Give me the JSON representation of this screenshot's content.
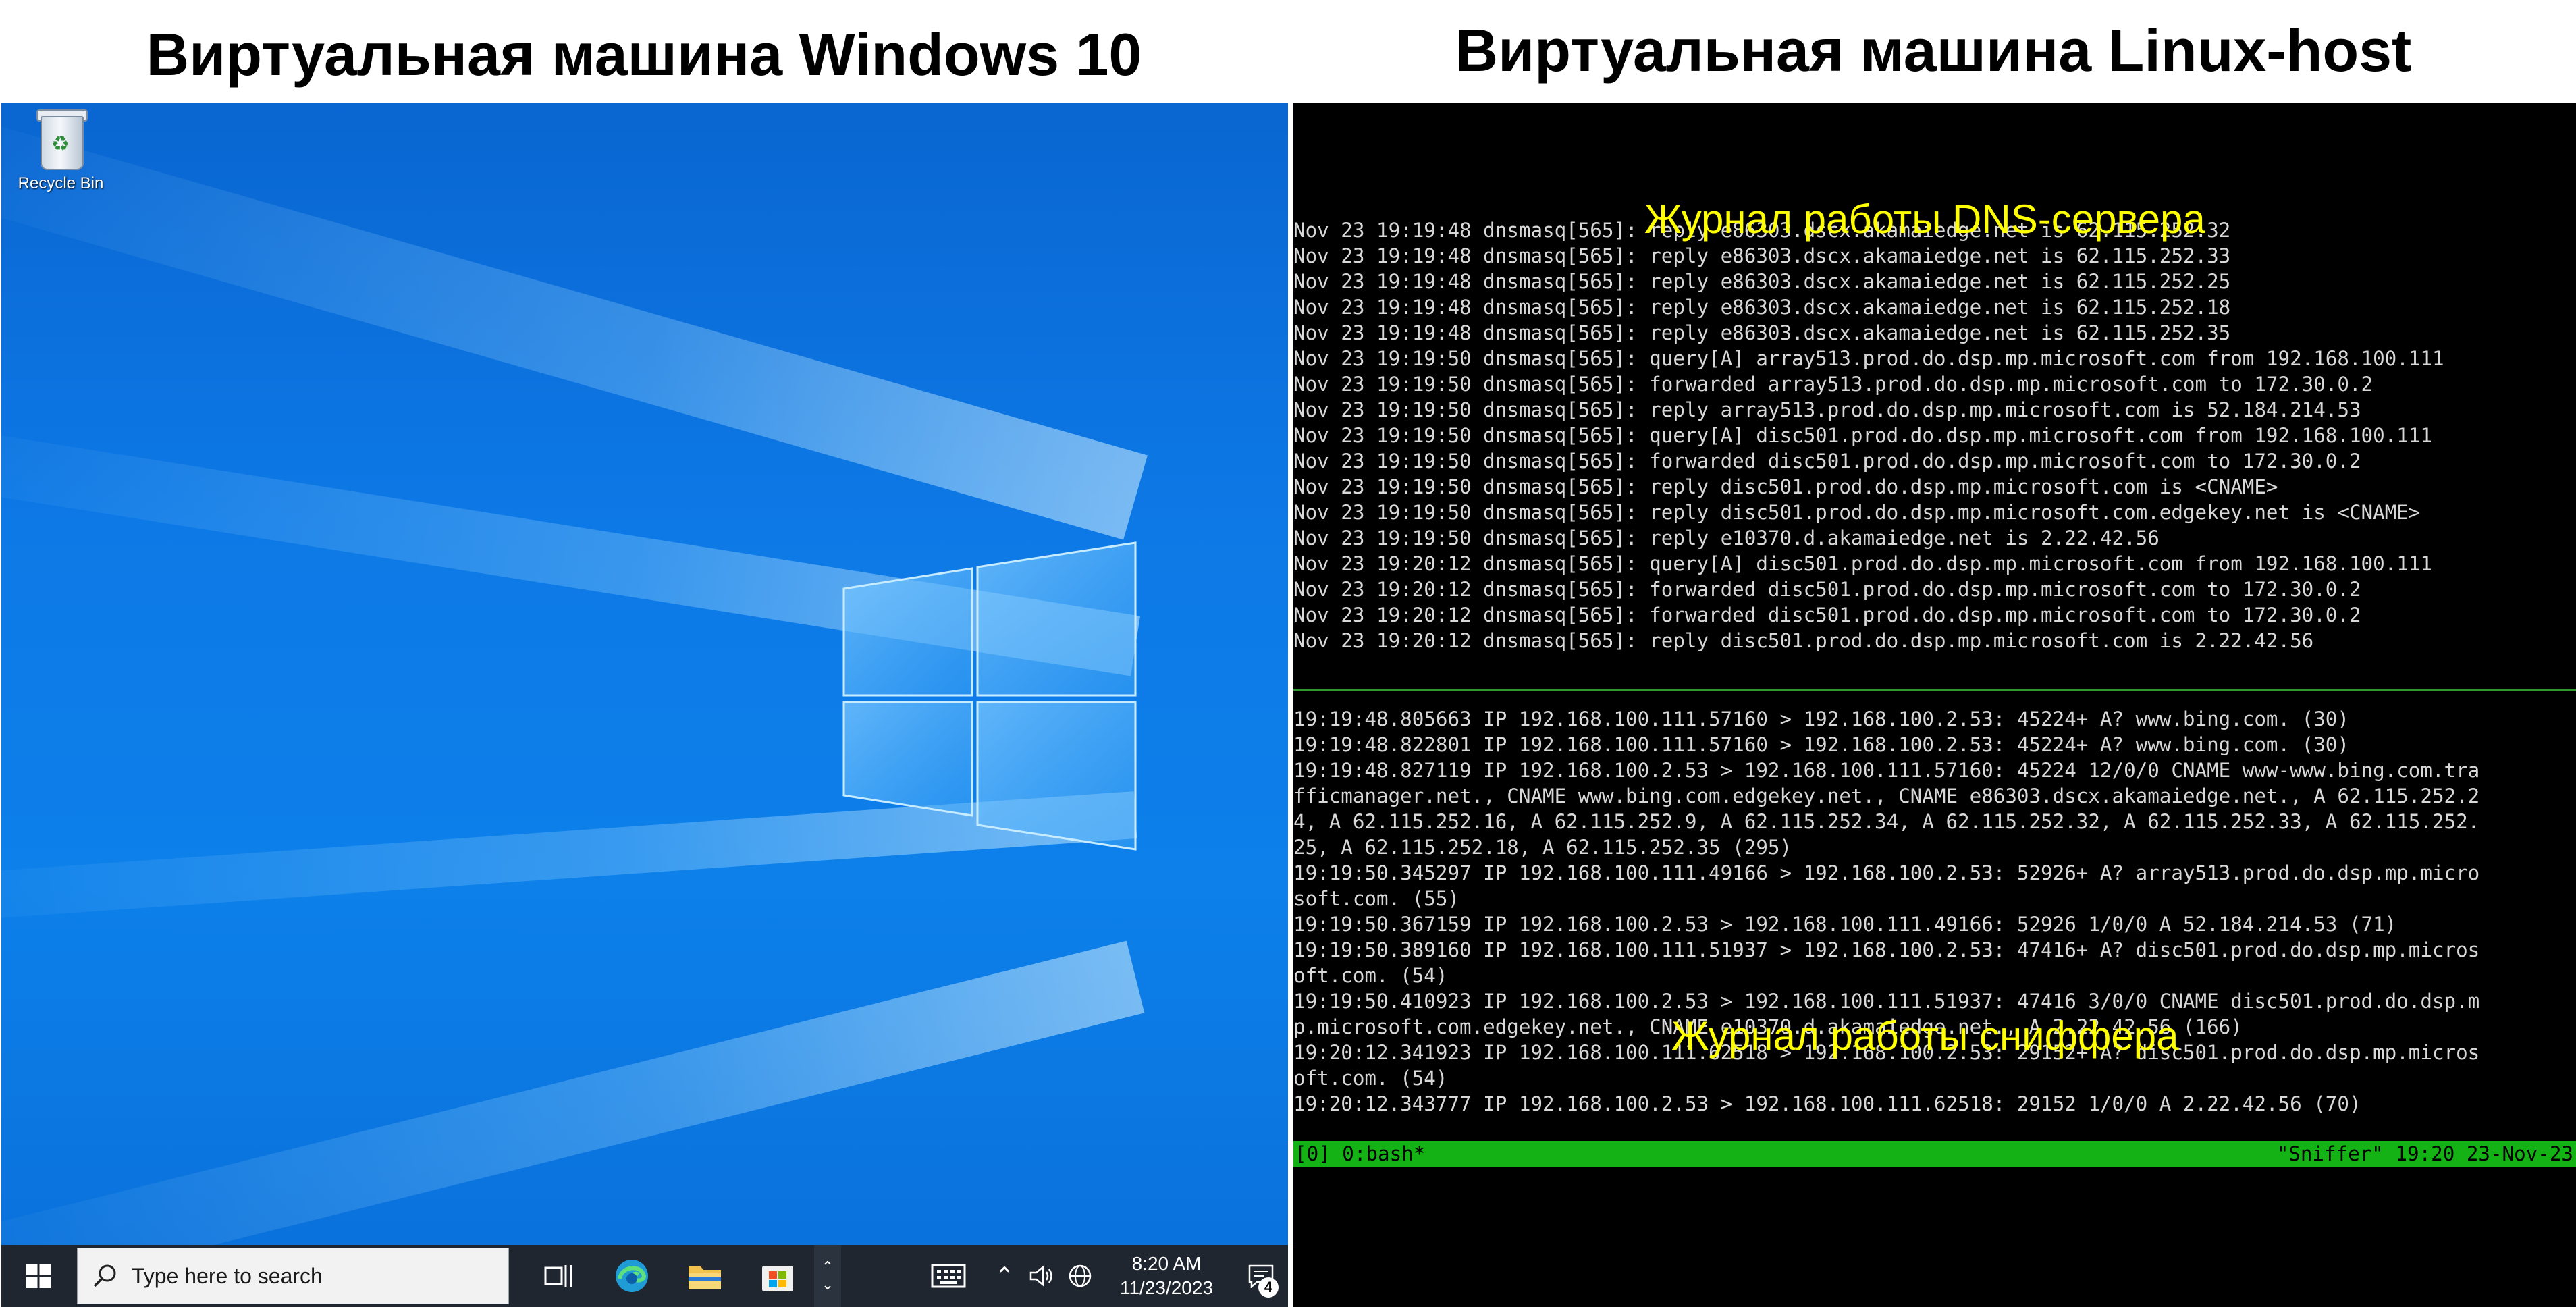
{
  "headings": {
    "windows_vm": "Виртуальная машина Windows 10",
    "linux_vm": "Виртуальная машина Linux-host"
  },
  "windows": {
    "desktop": {
      "recycle_bin_label": "Recycle Bin",
      "recycle_bin_icon": "recycle-bin-icon"
    },
    "taskbar": {
      "start_icon": "windows-logo-icon",
      "search_placeholder": "Type here to search",
      "apps": [
        "task-view-icon",
        "edge-icon",
        "file-explorer-icon",
        "microsoft-store-icon"
      ],
      "tray_icons": [
        "chevron-up-icon",
        "speaker-icon",
        "globe-icon",
        "keyboard-icon"
      ],
      "clock_time": "8:20 AM",
      "clock_date": "11/23/2023",
      "notification_count": "4"
    }
  },
  "linux": {
    "overlay_dns": "Журнал работы DNS-сервера",
    "overlay_sniffer": "Журнал работы сниффера",
    "dns_log": [
      "Nov 23 19:19:48 dnsmasq[565]: reply e86303.dscx.akamaiedge.net is 62.115.252.32",
      "Nov 23 19:19:48 dnsmasq[565]: reply e86303.dscx.akamaiedge.net is 62.115.252.33",
      "Nov 23 19:19:48 dnsmasq[565]: reply e86303.dscx.akamaiedge.net is 62.115.252.25",
      "Nov 23 19:19:48 dnsmasq[565]: reply e86303.dscx.akamaiedge.net is 62.115.252.18",
      "Nov 23 19:19:48 dnsmasq[565]: reply e86303.dscx.akamaiedge.net is 62.115.252.35",
      "Nov 23 19:19:50 dnsmasq[565]: query[A] array513.prod.do.dsp.mp.microsoft.com from 192.168.100.111",
      "Nov 23 19:19:50 dnsmasq[565]: forwarded array513.prod.do.dsp.mp.microsoft.com to 172.30.0.2",
      "Nov 23 19:19:50 dnsmasq[565]: reply array513.prod.do.dsp.mp.microsoft.com is 52.184.214.53",
      "Nov 23 19:19:50 dnsmasq[565]: query[A] disc501.prod.do.dsp.mp.microsoft.com from 192.168.100.111",
      "Nov 23 19:19:50 dnsmasq[565]: forwarded disc501.prod.do.dsp.mp.microsoft.com to 172.30.0.2",
      "Nov 23 19:19:50 dnsmasq[565]: reply disc501.prod.do.dsp.mp.microsoft.com is <CNAME>",
      "Nov 23 19:19:50 dnsmasq[565]: reply disc501.prod.do.dsp.mp.microsoft.com.edgekey.net is <CNAME>",
      "Nov 23 19:19:50 dnsmasq[565]: reply e10370.d.akamaiedge.net is 2.22.42.56",
      "Nov 23 19:20:12 dnsmasq[565]: query[A] disc501.prod.do.dsp.mp.microsoft.com from 192.168.100.111",
      "Nov 23 19:20:12 dnsmasq[565]: forwarded disc501.prod.do.dsp.mp.microsoft.com to 172.30.0.2",
      "Nov 23 19:20:12 dnsmasq[565]: forwarded disc501.prod.do.dsp.mp.microsoft.com to 172.30.0.2",
      "Nov 23 19:20:12 dnsmasq[565]: reply disc501.prod.do.dsp.mp.microsoft.com is 2.22.42.56"
    ],
    "sniffer_log": [
      "19:19:48.805663 IP 192.168.100.111.57160 > 192.168.100.2.53: 45224+ A? www.bing.com. (30)",
      "19:19:48.822801 IP 192.168.100.111.57160 > 192.168.100.2.53: 45224+ A? www.bing.com. (30)",
      "19:19:48.827119 IP 192.168.100.2.53 > 192.168.100.111.57160: 45224 12/0/0 CNAME www-www.bing.com.tra",
      "fficmanager.net., CNAME www.bing.com.edgekey.net., CNAME e86303.dscx.akamaiedge.net., A 62.115.252.2",
      "4, A 62.115.252.16, A 62.115.252.9, A 62.115.252.34, A 62.115.252.32, A 62.115.252.33, A 62.115.252.",
      "25, A 62.115.252.18, A 62.115.252.35 (295)",
      "19:19:50.345297 IP 192.168.100.111.49166 > 192.168.100.2.53: 52926+ A? array513.prod.do.dsp.mp.micro",
      "soft.com. (55)",
      "19:19:50.367159 IP 192.168.100.2.53 > 192.168.100.111.49166: 52926 1/0/0 A 52.184.214.53 (71)",
      "19:19:50.389160 IP 192.168.100.111.51937 > 192.168.100.2.53: 47416+ A? disc501.prod.do.dsp.mp.micros",
      "oft.com. (54)",
      "19:19:50.410923 IP 192.168.100.2.53 > 192.168.100.111.51937: 47416 3/0/0 CNAME disc501.prod.do.dsp.m",
      "p.microsoft.com.edgekey.net., CNAME e10370.d.akamaiedge.net., A 2.22.42.56 (166)",
      "19:20:12.341923 IP 192.168.100.111.62518 > 192.168.100.2.53: 29152+ A? disc501.prod.do.dsp.mp.micros",
      "oft.com. (54)",
      "19:20:12.343777 IP 192.168.100.2.53 > 192.168.100.111.62518: 29152 1/0/0 A 2.22.42.56 (70)"
    ],
    "status_bar": {
      "left": "[0] 0:bash*",
      "right": "\"Sniffer\" 19:20 23-Nov-23"
    }
  },
  "colors": {
    "desktop_blue": "#0d79e6",
    "taskbar": "#1f2630",
    "overlay_text": "#ffff00",
    "tmux_status": "#14b214",
    "terminal_text": "#d8d8d8"
  }
}
